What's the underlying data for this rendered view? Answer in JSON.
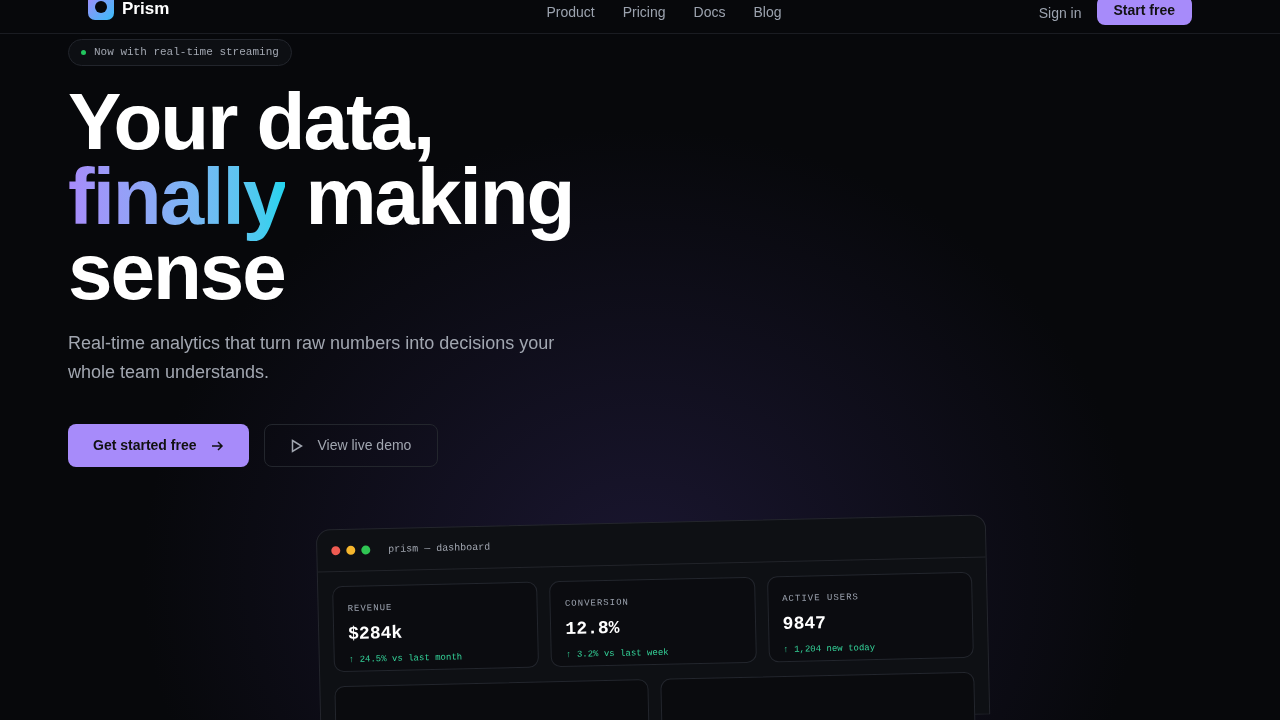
{
  "brand": {
    "name": "Prism"
  },
  "nav": {
    "links": [
      "Product",
      "Pricing",
      "Docs",
      "Blog"
    ],
    "sign_in": "Sign in",
    "cta": "Start free"
  },
  "badge": {
    "text": "Now with real-time streaming",
    "color": "#22c55e"
  },
  "headline": {
    "line1": "Your data,",
    "highlight": "finally",
    "line2_rest": "making",
    "line3": "sense"
  },
  "subtitle": "Real-time analytics that turn raw numbers into decisions your whole team understands.",
  "buttons": {
    "primary": "Get started free",
    "secondary": "View live demo"
  },
  "dashboard": {
    "title": "prism — dashboard",
    "stats": [
      {
        "label": "REVENUE",
        "value": "$284k",
        "delta": "↑ 24.5% vs last month"
      },
      {
        "label": "CONVERSION",
        "value": "12.8%",
        "delta": "↑ 3.2% vs last week"
      },
      {
        "label": "ACTIVE USERS",
        "value": "9847",
        "delta": "↑ 1,204 new today"
      }
    ]
  }
}
